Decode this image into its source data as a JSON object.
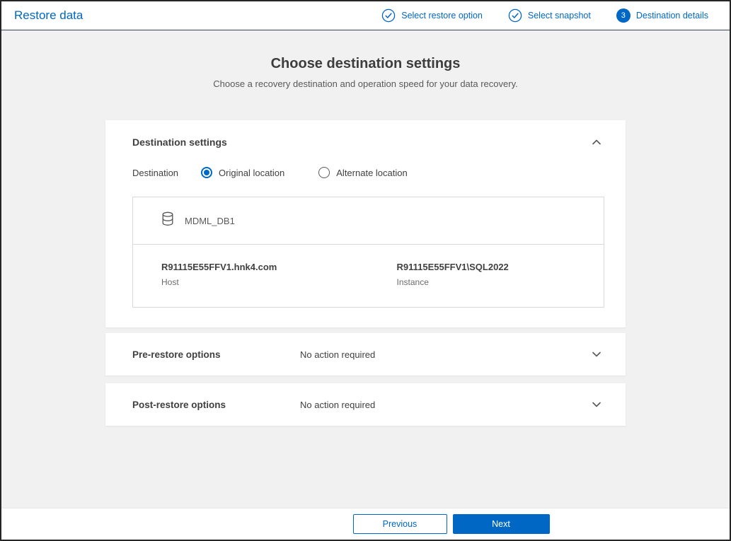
{
  "header": {
    "title": "Restore data",
    "steps": [
      {
        "label": "Select restore option",
        "state": "done"
      },
      {
        "label": "Select snapshot",
        "state": "done"
      },
      {
        "label": "Destination details",
        "state": "current",
        "number": "3"
      }
    ]
  },
  "main": {
    "title": "Choose destination settings",
    "subtitle": "Choose a recovery destination and operation speed for your data recovery.",
    "destination_card": {
      "title": "Destination settings",
      "destination_label": "Destination",
      "radios": [
        {
          "label": "Original location",
          "selected": true
        },
        {
          "label": "Alternate location",
          "selected": false
        }
      ],
      "database": {
        "name": "MDML_DB1",
        "host_value": "R91115E55FFV1.hnk4.com",
        "host_label": "Host",
        "instance_value": "R91115E55FFV1\\SQL2022",
        "instance_label": "Instance"
      }
    },
    "accordions": [
      {
        "title": "Pre-restore options",
        "status": "No action required"
      },
      {
        "title": "Post-restore options",
        "status": "No action required"
      }
    ]
  },
  "footer": {
    "previous_label": "Previous",
    "next_label": "Next"
  },
  "colors": {
    "accent": "#0067C5"
  }
}
